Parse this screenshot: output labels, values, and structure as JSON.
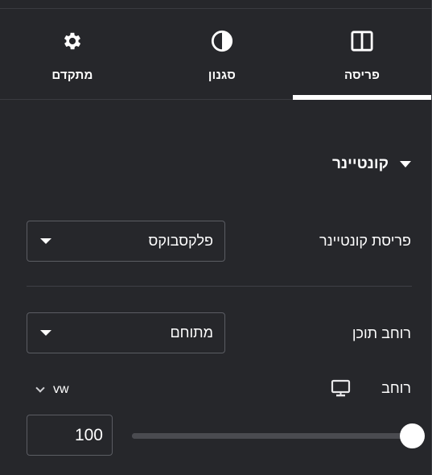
{
  "tabs": [
    {
      "id": "advanced",
      "label": "מתקדם",
      "icon": "gear-icon"
    },
    {
      "id": "style",
      "label": "סגנון",
      "icon": "half-circle-contrast-icon"
    },
    {
      "id": "layout",
      "label": "פריסה",
      "icon": "columns-layout-icon",
      "active": true
    }
  ],
  "section": {
    "title": "קונטיינר",
    "icon": "caret-down-icon"
  },
  "fields": {
    "container_layout": {
      "label": "פריסת קונטיינר",
      "value": "פלקסבוקס"
    },
    "content_width": {
      "label": "רוחב תוכן",
      "value": "מתוחם"
    },
    "width": {
      "label": "רוחב",
      "device_icon": "desktop-monitor-icon",
      "unit": "vw",
      "value": "100",
      "slider_fraction": 1.0
    }
  },
  "colors": {
    "background": "#26272b",
    "border": "#5b5d63",
    "text": "#ffffff"
  }
}
